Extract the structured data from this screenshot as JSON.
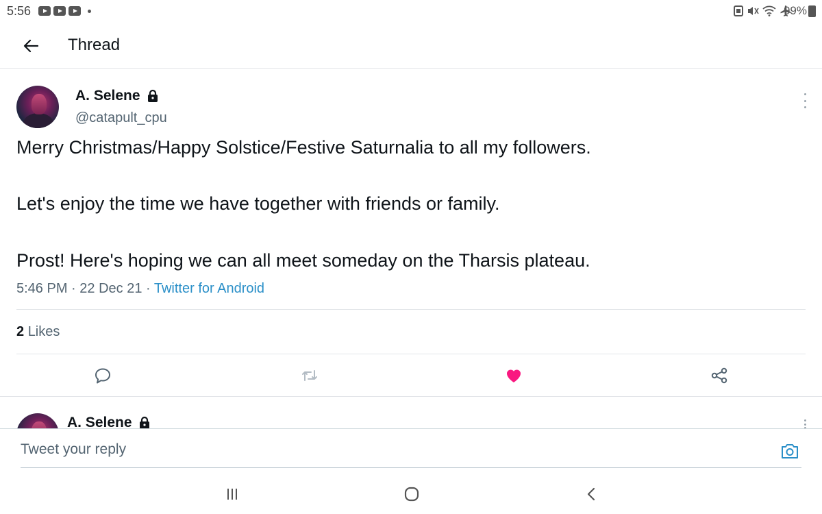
{
  "status_bar": {
    "time": "5:56",
    "notification_icons": [
      "youtube-icon",
      "youtube-icon",
      "youtube-icon",
      "dot-icon"
    ],
    "system_icons": [
      "nfc-icon",
      "mute-icon",
      "wifi-icon",
      "airplane-icon"
    ],
    "battery": "99%"
  },
  "header": {
    "title": "Thread"
  },
  "tweet": {
    "display_name": "A. Selene",
    "handle": "@catapult_cpu",
    "protected": true,
    "text_lines": [
      "Merry Christmas/Happy Solstice/Festive Saturnalia to all my followers.",
      "Let's enjoy the time we have together with friends or family.",
      "Prost! Here's hoping we can all meet someday on the Tharsis plateau."
    ],
    "time": "5:46 PM",
    "date": "22 Dec 21",
    "source": "Twitter for Android",
    "likes_count": "2",
    "likes_label": "Likes",
    "liked": true,
    "colors": {
      "like": "#f91880",
      "source_link": "#2a8fc8"
    }
  },
  "reply_tweet": {
    "display_name": "A. Selene"
  },
  "composer": {
    "placeholder": "Tweet your reply"
  },
  "nav_bar": {
    "buttons": [
      "recents-icon",
      "home-icon",
      "back-icon"
    ]
  }
}
